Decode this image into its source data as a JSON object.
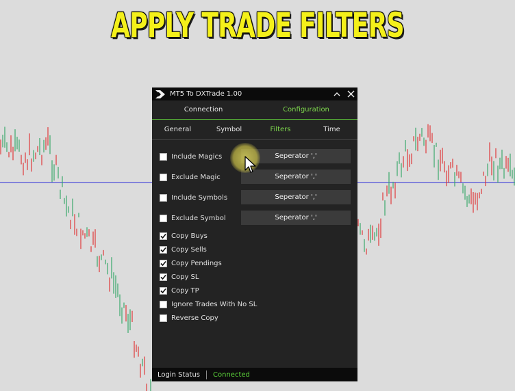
{
  "banner": {
    "text": "APPLY TRADE FILTERS"
  },
  "window": {
    "title": "MT5 To DXTrade 1.00",
    "logo_icon": "arrow-logo-icon",
    "minimize_icon": "caret-up-icon",
    "close_icon": "close-icon"
  },
  "main_tabs": [
    {
      "label": "Connection",
      "active": false
    },
    {
      "label": "Configuration",
      "active": true
    }
  ],
  "sub_tabs": [
    {
      "label": "General",
      "active": false
    },
    {
      "label": "Symbol",
      "active": false
    },
    {
      "label": "Filters",
      "active": true
    },
    {
      "label": "Time",
      "active": false
    }
  ],
  "filters": [
    {
      "label": "Include Magics",
      "checked": false,
      "field": "Seperator ','"
    },
    {
      "label": "Exclude Magic",
      "checked": false,
      "field": "Seperator ','"
    },
    {
      "label": "Include Symbols",
      "checked": false,
      "field": "Seperator ','"
    },
    {
      "label": "Exclude Symbol",
      "checked": false,
      "field": "Seperator ','"
    }
  ],
  "options": [
    {
      "label": "Copy Buys",
      "checked": true
    },
    {
      "label": "Copy Sells",
      "checked": true
    },
    {
      "label": "Copy Pendings",
      "checked": true
    },
    {
      "label": "Copy SL",
      "checked": true
    },
    {
      "label": "Copy TP",
      "checked": true
    },
    {
      "label": "Ignore Trades With No SL",
      "checked": false
    },
    {
      "label": "Reverse Copy",
      "checked": false
    }
  ],
  "status": {
    "label": "Login Status",
    "value": "Connected"
  },
  "colors": {
    "accent_green": "#7ed84d",
    "panel_bg": "#232323",
    "banner_yellow": "#f4f01a",
    "candle_up": "#3aa86b",
    "candle_down": "#e0393a",
    "price_line": "#2a2ad8"
  }
}
